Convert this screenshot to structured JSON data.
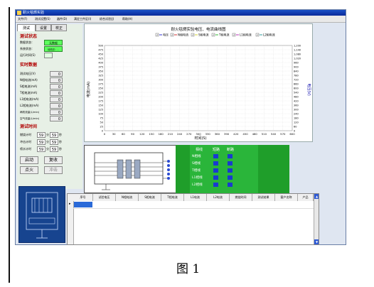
{
  "window": {
    "title": "耐火毯燃实验"
  },
  "menu": [
    "文件(F)",
    "测试设置(S)",
    "器件(D)",
    "满定工件区(I)",
    "综合试验(J)",
    "帮助(H)"
  ],
  "tabs": [
    "测试",
    "设置",
    "校正"
  ],
  "status_section": {
    "heading": "测试状态",
    "rows": [
      {
        "label": "数据状态：",
        "value": "无数据"
      },
      {
        "label": "系统状态：",
        "value": "待机中. . ."
      },
      {
        "label": "运行时间(S)",
        "value": ""
      }
    ]
  },
  "realtime_section": {
    "heading": "实时数据",
    "rows": [
      {
        "label": "测试电压(V)",
        "value": "0"
      },
      {
        "label": "N相电流(mA)",
        "value": "0"
      },
      {
        "label": "S相电流(mA)",
        "value": "0"
      },
      {
        "label": "T相电流(mA)",
        "value": "0"
      },
      {
        "label": "L1相电流(mA)",
        "value": "0"
      },
      {
        "label": "L2相电流(mA)",
        "value": "0"
      },
      {
        "label": "两机流量(L/min)",
        "value": "0"
      },
      {
        "label": "空气流量(L/min)",
        "value": "0"
      }
    ]
  },
  "time_section": {
    "heading": "测试时间",
    "rows": [
      {
        "label": "燃烧计时",
        "min": "59",
        "sec": "59",
        "sep": "分",
        "unit": "秒"
      },
      {
        "label": "冲击计时",
        "min": "59",
        "sec": "59",
        "sep": "分",
        "unit": "秒"
      },
      {
        "label": "喷水计时",
        "min": "59",
        "sec": "59",
        "sep": "分",
        "unit": "秒"
      }
    ]
  },
  "buttons": {
    "start": "启动",
    "stop": "复收",
    "ignite": "点火",
    "impact": "冲击"
  },
  "chart_data": {
    "type": "line",
    "title": "耐火毯燃实验电压、电流曲线图",
    "legend": [
      "电压",
      "N相电流",
      "S相电流",
      "T相电流",
      "L1相电流",
      "L2相电流"
    ],
    "legend_colors": [
      "#0000cc",
      "#cc0000",
      "#cccc00",
      "#00aa00",
      "#aa00aa",
      "#008888"
    ],
    "xlabel": "时间(S)",
    "ylabel": "电流(mA)",
    "y2label": "电压(V)",
    "x_ticks": [
      0,
      30,
      60,
      90,
      120,
      150,
      180,
      210,
      240,
      270,
      300,
      330,
      360,
      390,
      420,
      450,
      480,
      510,
      540,
      570,
      600
    ],
    "y_ticks": [
      0,
      25,
      50,
      75,
      100,
      125,
      150,
      175,
      200,
      225,
      250,
      275,
      300,
      325,
      350,
      375,
      400,
      425,
      450,
      475,
      500
    ],
    "y2_ticks": [
      0,
      60,
      120,
      180,
      240,
      300,
      360,
      420,
      480,
      540,
      600,
      660,
      720,
      780,
      840,
      900,
      960,
      1020,
      1080,
      1140,
      1200
    ],
    "xlim": [
      0,
      600
    ],
    "ylim": [
      0,
      500
    ],
    "y2lim": [
      0,
      1200
    ],
    "grid": true,
    "series": []
  },
  "phase_panel": {
    "headers": [
      "相线",
      "短路",
      "断路"
    ],
    "rows": [
      "N相线",
      "S相线",
      "T相线",
      "L1相线",
      "L2相线"
    ]
  },
  "table": {
    "columns": [
      "序号",
      "试验电压",
      "N相电流",
      "S相电流",
      "T相电流",
      "L1电流",
      "L2电流",
      "燃烧时间",
      "测试结果",
      "客户名称",
      "产品"
    ]
  },
  "caption": "图 1"
}
